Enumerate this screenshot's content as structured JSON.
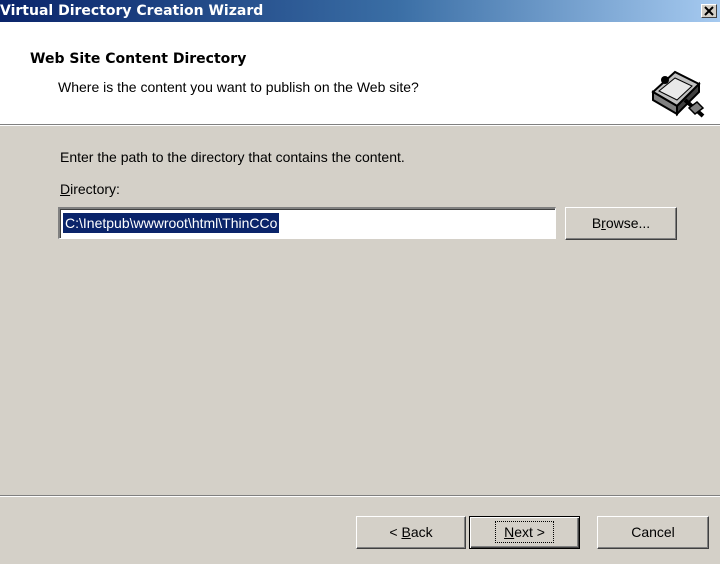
{
  "window": {
    "title": "Virtual Directory Creation Wizard"
  },
  "header": {
    "title": "Web Site Content Directory",
    "subtitle": "Where is the content you want to publish on the Web site?",
    "icon": "folder-wizard-icon"
  },
  "body": {
    "instruction": "Enter the path to the directory that contains the content.",
    "directory_label_mnemonic": "D",
    "directory_label_rest": "irectory:",
    "directory_value": "C:\\Inetpub\\wwwroot\\html\\ThinCCo",
    "browse": {
      "pre": "B",
      "mnemonic": "r",
      "post": "owse..."
    }
  },
  "footer": {
    "back": {
      "pre": "< ",
      "mnemonic": "B",
      "post": "ack"
    },
    "next": {
      "mnemonic": "N",
      "post": "ext >"
    },
    "cancel": "Cancel"
  },
  "colors": {
    "titlebar_start": "#0a246a",
    "titlebar_end": "#a6caf0",
    "selection": "#0a246a",
    "face": "#d4d0c8"
  }
}
